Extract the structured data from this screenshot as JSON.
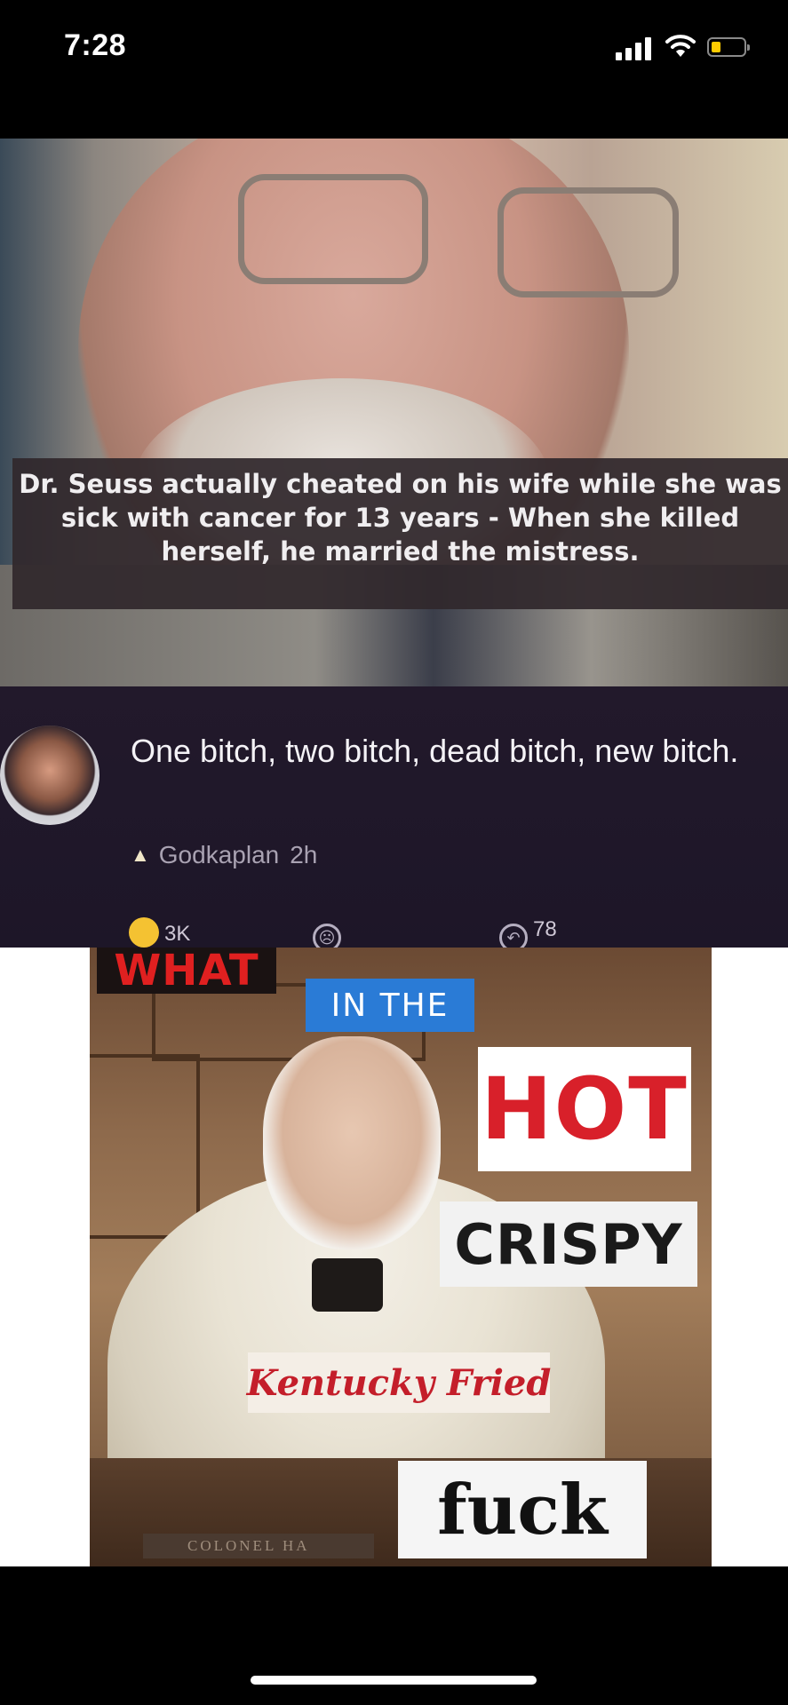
{
  "status_bar": {
    "time": "7:28",
    "battery_color": "#ffcc00",
    "icons": [
      "signal-icon",
      "wifi-icon",
      "battery-icon"
    ]
  },
  "meme1": {
    "caption": "Dr. Seuss actually cheated on his wife while she was sick with cancer for 13 years - When she killed herself, he married the mistress.",
    "comment": {
      "text": "One bitch, two bitch, dead bitch, new bitch.",
      "username": "Godkaplan",
      "time": "2h",
      "reactions": [
        {
          "icon": "laugh-emoji-icon",
          "count": "3K"
        },
        {
          "icon": "sad-face-icon",
          "count": ""
        },
        {
          "icon": "reply-icon",
          "count": "78"
        }
      ]
    }
  },
  "meme2": {
    "labels": {
      "what": "WHAT",
      "in_the": "IN THE",
      "hot": "HOT",
      "crispy": "CRISPY",
      "kentucky_fried": "Kentucky Fried",
      "fuck": "fuck"
    },
    "plaque": "COLONEL HA"
  }
}
